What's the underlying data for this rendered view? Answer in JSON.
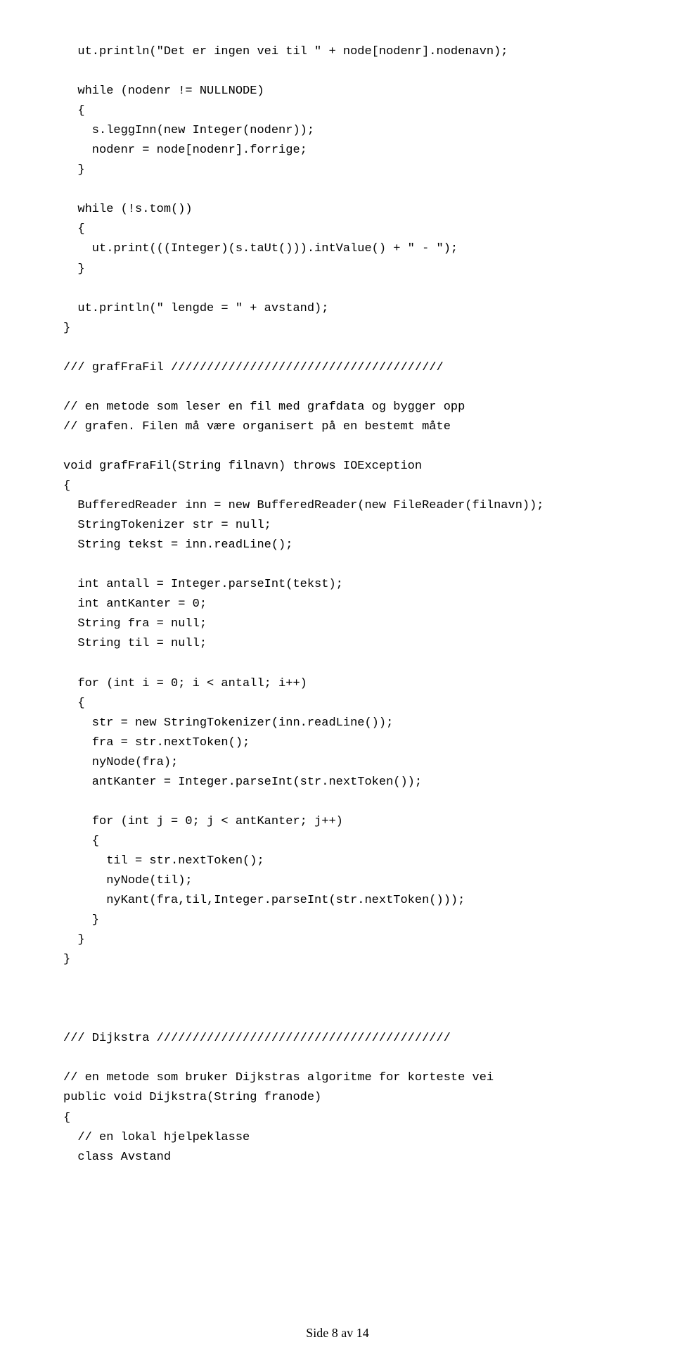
{
  "code": {
    "lines": [
      "  ut.println(\"Det er ingen vei til \" + node[nodenr].nodenavn);",
      "",
      "  while (nodenr != NULLNODE)",
      "  {",
      "    s.leggInn(new Integer(nodenr));",
      "    nodenr = node[nodenr].forrige;",
      "  }",
      "",
      "  while (!s.tom())",
      "  {",
      "    ut.print(((Integer)(s.taUt())).intValue() + \" - \");",
      "  }",
      "",
      "  ut.println(\" lengde = \" + avstand);",
      "}",
      "",
      "/// grafFraFil //////////////////////////////////////",
      "",
      "// en metode som leser en fil med grafdata og bygger opp",
      "// grafen. Filen må være organisert på en bestemt måte",
      "",
      "void grafFraFil(String filnavn) throws IOException",
      "{",
      "  BufferedReader inn = new BufferedReader(new FileReader(filnavn));",
      "  StringTokenizer str = null;",
      "  String tekst = inn.readLine();",
      "",
      "  int antall = Integer.parseInt(tekst);",
      "  int antKanter = 0;",
      "  String fra = null;",
      "  String til = null;",
      "",
      "  for (int i = 0; i < antall; i++)",
      "  {",
      "    str = new StringTokenizer(inn.readLine());",
      "    fra = str.nextToken();",
      "    nyNode(fra);",
      "    antKanter = Integer.parseInt(str.nextToken());",
      "",
      "    for (int j = 0; j < antKanter; j++)",
      "    {",
      "      til = str.nextToken();",
      "      nyNode(til);",
      "      nyKant(fra,til,Integer.parseInt(str.nextToken()));",
      "    }",
      "  }",
      "}",
      "",
      "",
      "",
      "/// Dijkstra /////////////////////////////////////////",
      "",
      "// en metode som bruker Dijkstras algoritme for korteste vei",
      "public void Dijkstra(String franode)",
      "{",
      "  // en lokal hjelpeklasse",
      "  class Avstand"
    ]
  },
  "footer": {
    "text": "Side 8 av 14"
  }
}
